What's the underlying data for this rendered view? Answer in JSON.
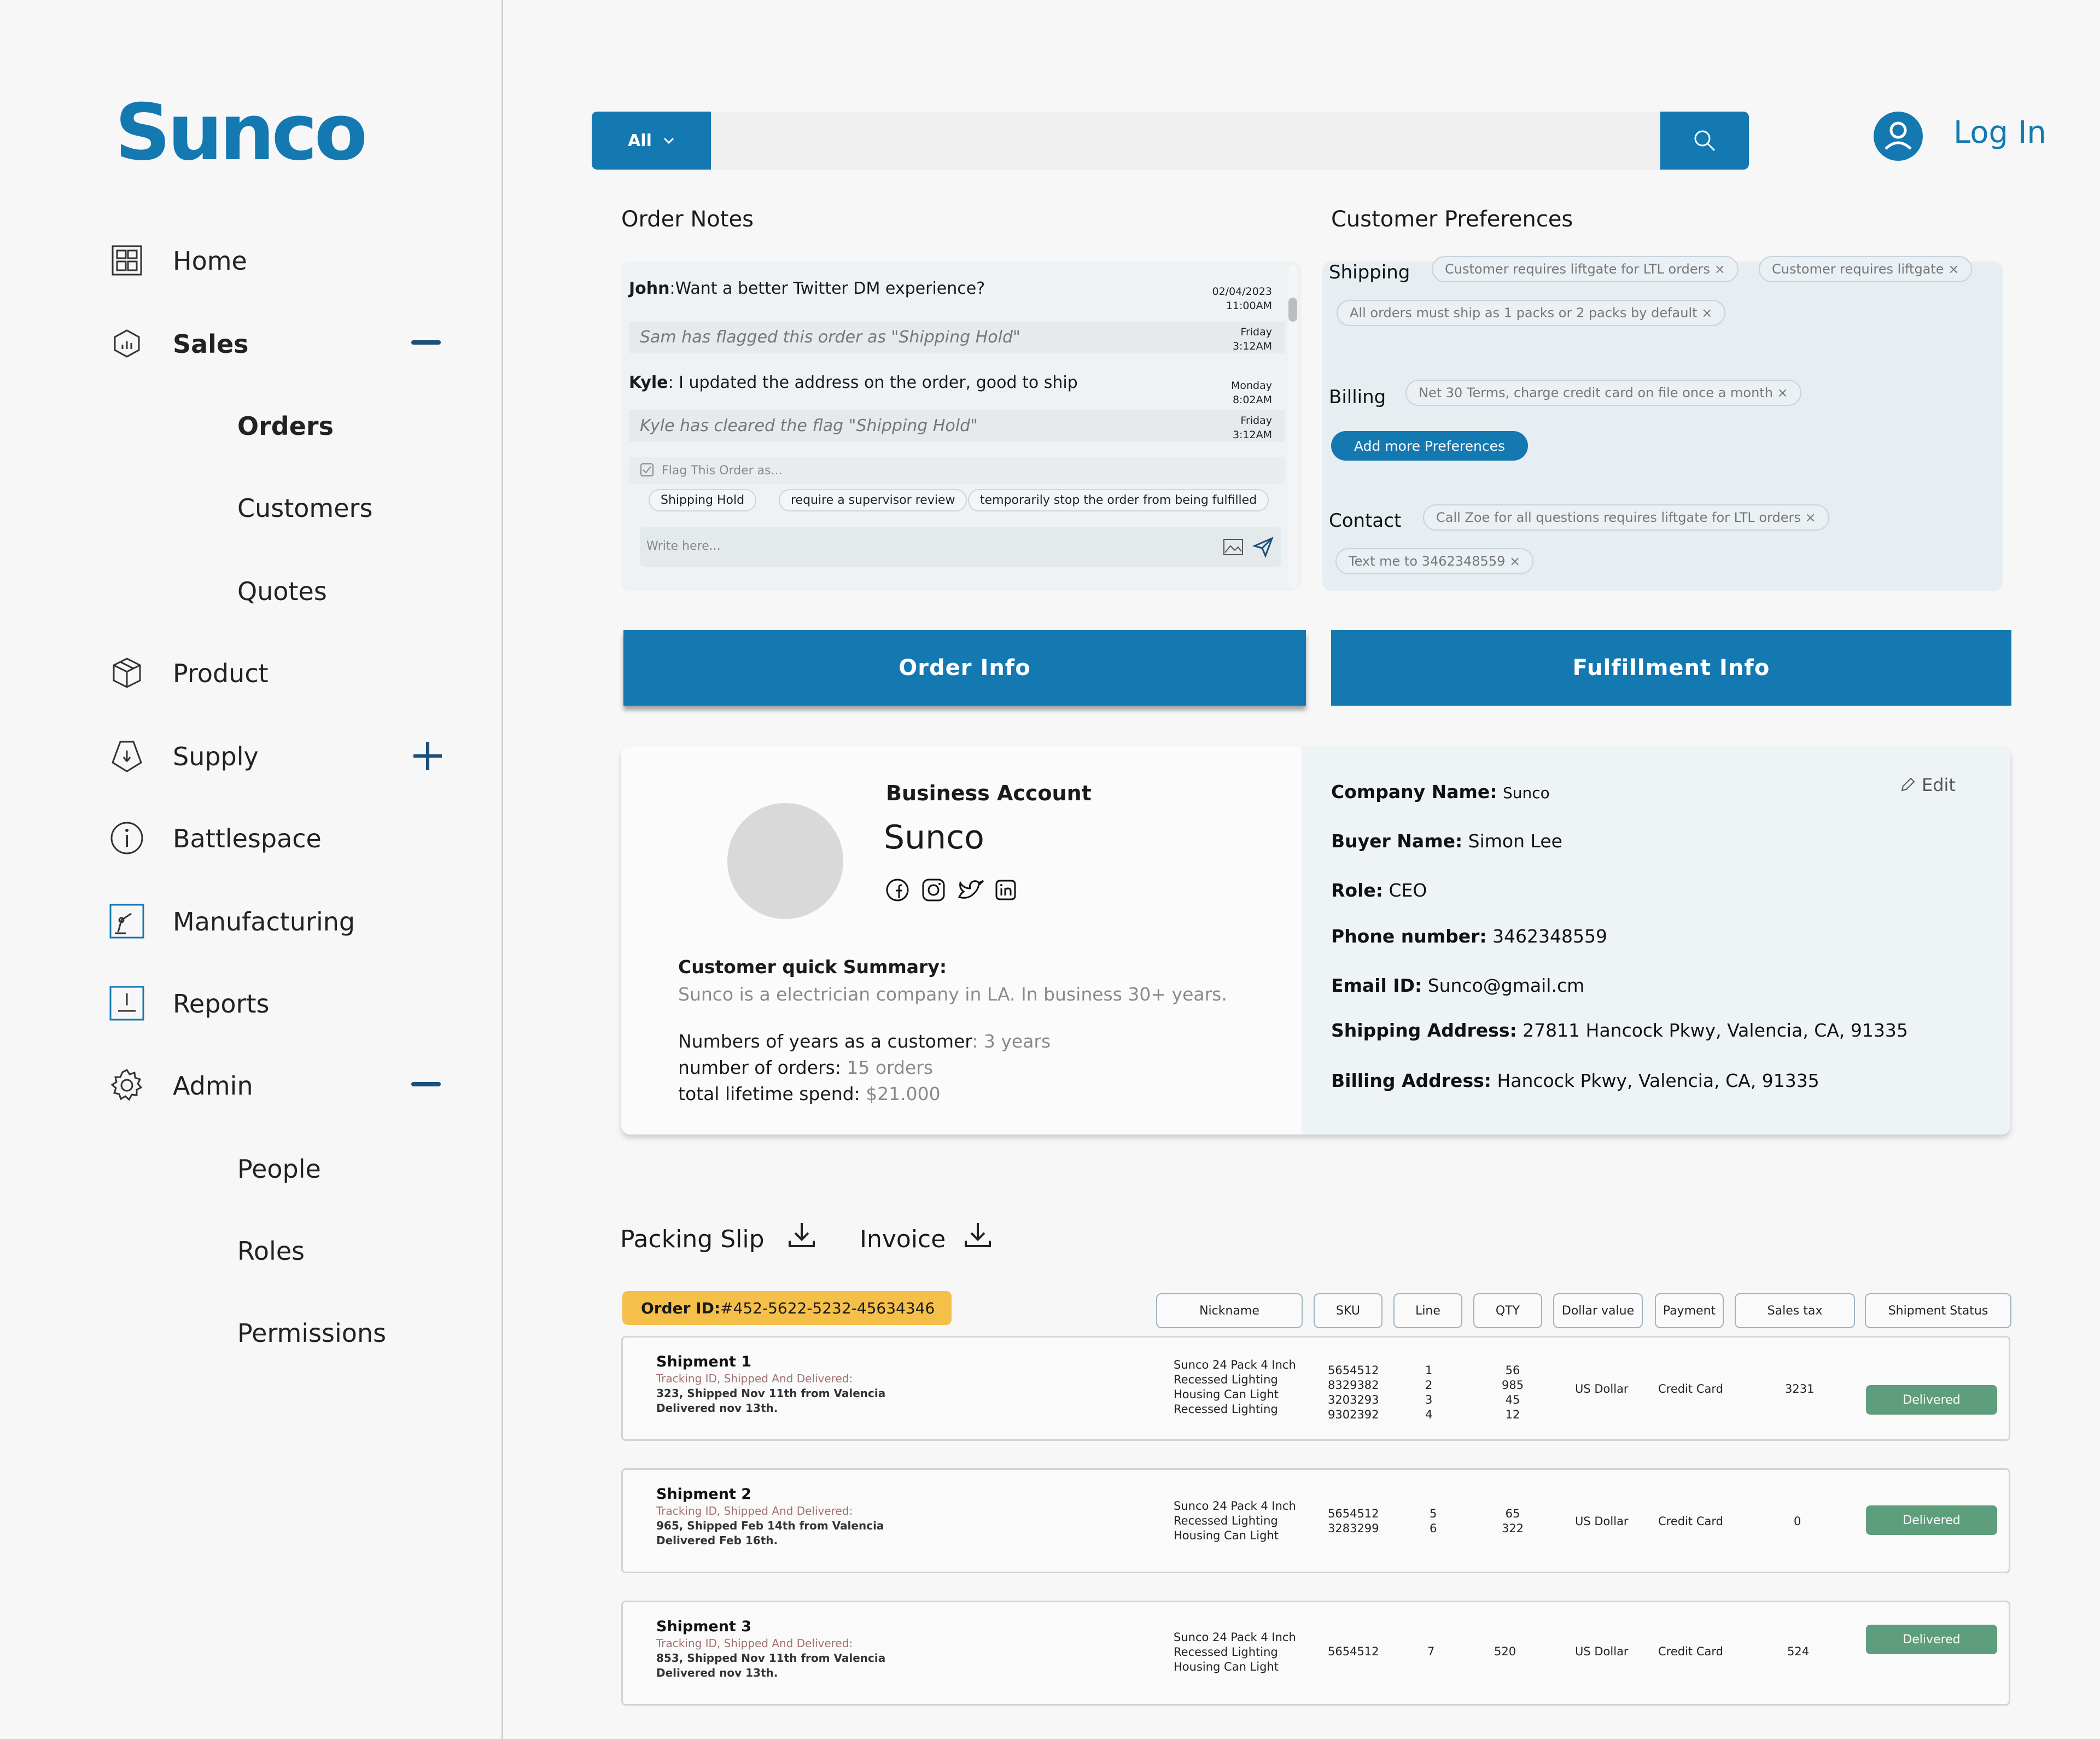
{
  "app": {
    "logo": "Sunco"
  },
  "sidebar": {
    "items": [
      {
        "label": "Home"
      },
      {
        "label": "Sales"
      },
      {
        "label": "Orders"
      },
      {
        "label": "Customers"
      },
      {
        "label": "Quotes"
      },
      {
        "label": "Product"
      },
      {
        "label": "Supply"
      },
      {
        "label": "Battlespace"
      },
      {
        "label": "Manufacturing"
      },
      {
        "label": "Reports"
      },
      {
        "label": "Admin"
      },
      {
        "label": "People"
      },
      {
        "label": "Roles"
      },
      {
        "label": "Permissions"
      }
    ]
  },
  "search": {
    "filter_label": "All",
    "placeholder": ""
  },
  "header": {
    "login_label": "Log In"
  },
  "order_notes": {
    "title": "Order Notes",
    "messages": [
      {
        "who": "John",
        "text": ":Want a better Twitter DM experience?",
        "date": "02/04/2023",
        "time": "11:00AM"
      },
      {
        "text": "Sam has flagged this order as \"Shipping Hold\"",
        "date": "Friday",
        "time": "3:12AM"
      },
      {
        "who": "Kyle",
        "text": ": I updated the address on the order, good to ship",
        "date": "Monday",
        "time": "8:02AM"
      },
      {
        "text": "Kyle has cleared the flag \"Shipping Hold\"",
        "date": "Friday",
        "time": "3:12AM"
      }
    ],
    "flag_label": "Flag This Order as...",
    "flag_options": [
      "Shipping Hold",
      "require a supervisor review",
      "temporarily stop the order from being fulfilled"
    ],
    "input_placeholder": "Write here..."
  },
  "customer_prefs": {
    "title": "Customer Preferences",
    "shipping_label": "Shipping",
    "shipping_chips": [
      "Customer requires liftgate for LTL orders",
      "Customer requires liftgate",
      "All orders must ship as 1 packs or 2 packs by default"
    ],
    "billing_label": "Billing",
    "billing_chips": [
      "Net 30 Terms, charge credit card on file once a month"
    ],
    "add_button": "Add more Preferences",
    "contact_label": "Contact",
    "contact_chips": [
      "Call Zoe for all questions requires liftgate for LTL orders",
      "Text me to 3462348559"
    ]
  },
  "tabs": {
    "order_info": "Order Info",
    "fulfillment_info": "Fulfillment Info"
  },
  "account": {
    "type": "Business Account",
    "name": "Sunco",
    "summary_label": "Customer quick Summary:",
    "summary_text": "Sunco is a electrician company in LA. In business 30+ years.",
    "years_label": "Numbers of years as a customer",
    "years_value": ": 3 years",
    "orders_label": "number of orders:",
    "orders_value": "15 orders",
    "spend_label": "total lifetime spend:",
    "spend_value": "$21.000",
    "edit_label": "Edit",
    "company_label": "Company Name:",
    "company_value": "Sunco",
    "buyer_label": "Buyer Name:",
    "buyer_value": "Simon Lee",
    "role_label": "Role:",
    "role_value": "CEO",
    "phone_label": "Phone number:",
    "phone_value": "3462348559",
    "email_label": "Email ID:",
    "email_value": "Sunco@gmail.cm",
    "ship_addr_label": "Shipping Address:",
    "ship_addr_value": "27811 Hancock Pkwy, Valencia, CA, 91335",
    "bill_addr_label": "Billing Address:",
    "bill_addr_value": "Hancock Pkwy, Valencia, CA, 91335"
  },
  "docs": {
    "packing_slip": "Packing Slip",
    "invoice": "Invoice"
  },
  "order": {
    "id_label": "Order ID:",
    "id_value": "#452-5622-5232-45634346",
    "columns": [
      "Nickname",
      "SKU",
      "Line",
      "QTY",
      "Dollar value",
      "Payment",
      "Sales tax",
      "Shipment Status"
    ],
    "shipments": [
      {
        "title": "Shipment 1",
        "sub": "Tracking ID, Shipped And Delivered:",
        "detail1": "323, Shipped Nov 11th from Valencia",
        "detail2": "Delivered nov 13th.",
        "nickname": [
          "Sunco 24 Pack 4 Inch",
          "Recessed Lighting",
          "Housing Can Light",
          "Recessed Lighting"
        ],
        "sku": [
          "5654512",
          "8329382",
          "3203293",
          "9302392"
        ],
        "line": [
          "1",
          "2",
          "3",
          "4"
        ],
        "qty": [
          "56",
          "985",
          "45",
          "12"
        ],
        "dollar": "US Dollar",
        "payment": "Credit Card",
        "tax": "3231",
        "status": "Delivered"
      },
      {
        "title": "Shipment 2",
        "sub": "Tracking ID, Shipped And Delivered:",
        "detail1": "965, Shipped Feb 14th from Valencia",
        "detail2": "Delivered Feb 16th.",
        "nickname": [
          "Sunco 24 Pack 4 Inch",
          "Recessed Lighting",
          "Housing Can Light"
        ],
        "sku": [
          "5654512",
          "3283299"
        ],
        "line": [
          "5",
          "6"
        ],
        "qty": [
          "65",
          "322"
        ],
        "dollar": "US Dollar",
        "payment": "Credit Card",
        "tax": "0",
        "status": "Delivered"
      },
      {
        "title": "Shipment 3",
        "sub": "Tracking ID, Shipped And Delivered:",
        "detail1": "853, Shipped Nov 11th from Valencia",
        "detail2": "Delivered nov 13th.",
        "nickname": [
          "Sunco 24 Pack 4 Inch",
          "Recessed Lighting",
          "Housing Can Light"
        ],
        "sku": [
          "5654512"
        ],
        "line": [
          "7"
        ],
        "qty": [
          "520"
        ],
        "dollar": "US Dollar",
        "payment": "Credit Card",
        "tax": "524",
        "status": "Delivered"
      }
    ]
  },
  "colors": {
    "brand": "#1478b1",
    "delivered": "#5f9e7c",
    "order_id_bg": "#f5c04a"
  }
}
